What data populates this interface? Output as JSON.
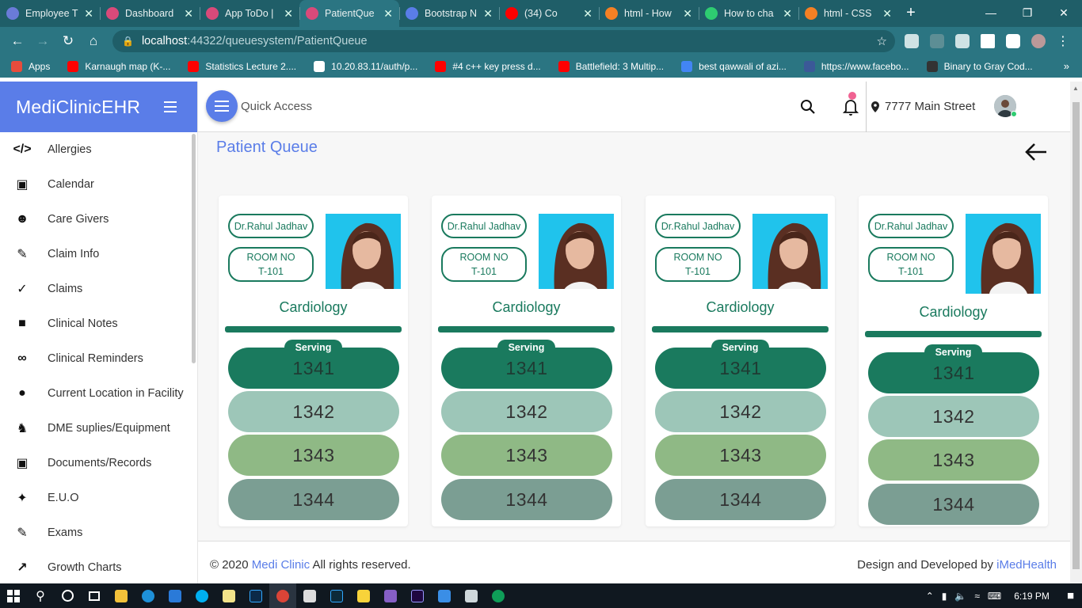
{
  "browser": {
    "tabs": [
      {
        "title": "Employee T",
        "color": "#6a7bd8",
        "active": false
      },
      {
        "title": "Dashboard",
        "color": "#d94a7a",
        "active": false
      },
      {
        "title": "App ToDo |",
        "color": "#d94a7a",
        "active": false
      },
      {
        "title": "PatientQue",
        "color": "#d94a7a",
        "active": true
      },
      {
        "title": "Bootstrap N",
        "color": "#5a7de8",
        "active": false
      },
      {
        "title": "(34) Co",
        "color": "#ff0000",
        "active": false
      },
      {
        "title": "html - How",
        "color": "#f48024",
        "active": false
      },
      {
        "title": "How to cha",
        "color": "#2ecc71",
        "active": false
      },
      {
        "title": "html - CSS",
        "color": "#f48024",
        "active": false
      }
    ],
    "new_tab_icon": "plus-icon",
    "url_host": "localhost",
    "url_path": ":44322/queuesystem/PatientQueue",
    "bookmarks": [
      {
        "label": "Apps",
        "color": "#e74c3c"
      },
      {
        "label": "Karnaugh map (K-...",
        "color": "#ff0000"
      },
      {
        "label": "Statistics Lecture 2....",
        "color": "#ff0000"
      },
      {
        "label": "10.20.83.11/auth/p...",
        "color": "#ffffff"
      },
      {
        "label": "#4 c++ key press d...",
        "color": "#ff0000"
      },
      {
        "label": "Battlefield: 3 Multip...",
        "color": "#ff0000"
      },
      {
        "label": "best qawwali of azi...",
        "color": "#4285f4"
      },
      {
        "label": "https://www.facebo...",
        "color": "#3b5998"
      },
      {
        "label": "Binary to Gray Cod...",
        "color": "#333333"
      }
    ],
    "bookmarks_more": "»"
  },
  "app": {
    "brand": "MediClinicEHR",
    "quick_access": "Quick Access",
    "location": "7777 Main Street",
    "primary_color": "#5a7de8",
    "accent_green": "#1a7a5e",
    "sidebar": [
      {
        "label": "Allergies",
        "icon": "code-icon"
      },
      {
        "label": "Calendar",
        "icon": "calendar-icon"
      },
      {
        "label": "Care Givers",
        "icon": "face-icon"
      },
      {
        "label": "Claim Info",
        "icon": "pencil-icon"
      },
      {
        "label": "Claims",
        "icon": "check-icon"
      },
      {
        "label": "Clinical Notes",
        "icon": "note-icon"
      },
      {
        "label": "Clinical Reminders",
        "icon": "link-icon"
      },
      {
        "label": "Current Location in Facility",
        "icon": "pin-icon"
      },
      {
        "label": "DME suplies/Equipment",
        "icon": "stroller-icon"
      },
      {
        "label": "Documents/Records",
        "icon": "book-icon"
      },
      {
        "label": "E.U.O",
        "icon": "ticket-icon"
      },
      {
        "label": "Exams",
        "icon": "pencil-icon"
      },
      {
        "label": "Growth Charts",
        "icon": "trending-up-icon"
      }
    ]
  },
  "page": {
    "title": "Patient Queue",
    "cards": [
      {
        "doctor": "Dr.Rahul Jadhav",
        "room_label": "ROOM NO",
        "room": "T-101",
        "specialty": "Cardiology",
        "serving_label": "Serving",
        "tokens": [
          "1341",
          "1342",
          "1343",
          "1344"
        ]
      },
      {
        "doctor": "Dr.Rahul Jadhav",
        "room_label": "ROOM NO",
        "room": "T-101",
        "specialty": "Cardiology",
        "serving_label": "Serving",
        "tokens": [
          "1341",
          "1342",
          "1343",
          "1344"
        ]
      },
      {
        "doctor": "Dr.Rahul Jadhav",
        "room_label": "ROOM NO",
        "room": "T-101",
        "specialty": "Cardiology",
        "serving_label": "Serving",
        "tokens": [
          "1341",
          "1342",
          "1343",
          "1344"
        ]
      },
      {
        "doctor": "Dr.Rahul Jadhav",
        "room_label": "ROOM NO",
        "room": "T-101",
        "specialty": "Cardiology",
        "serving_label": "Serving",
        "tokens": [
          "1341",
          "1342",
          "1343",
          "1344"
        ]
      }
    ]
  },
  "footer": {
    "prefix": "© 2020",
    "brand_link": "Medi Clinic",
    "rights": "All rights reserved.",
    "dev_prefix": "Design and Developed by",
    "dev_link": "iMedHealth"
  },
  "taskbar": {
    "time": "6:19 PM"
  }
}
